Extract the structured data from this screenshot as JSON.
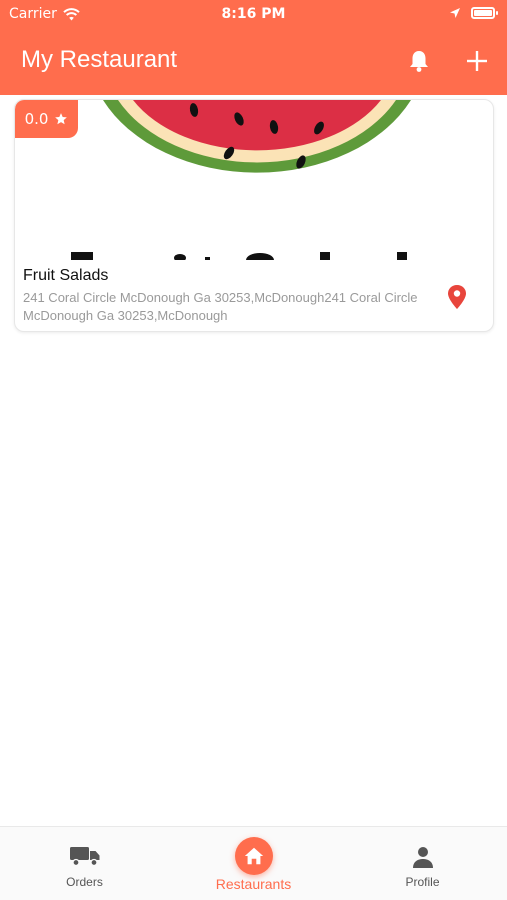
{
  "status_bar": {
    "carrier": "Carrier",
    "time": "8:16 PM"
  },
  "nav": {
    "title": "My Restaurant",
    "icons": [
      "bell-icon",
      "plus-icon"
    ]
  },
  "restaurant": {
    "rating": "0.0",
    "name": "Fruit Salads",
    "address": "241 Coral Circle McDonough Ga 30253,McDonough241 Coral Circle McDonough Ga 30253,McDonough"
  },
  "tabbar": {
    "orders": "Orders",
    "restaurants": "Restaurants",
    "profile": "Profile"
  },
  "colors": {
    "accent": "#ff6d4d",
    "pin": "#e8453c",
    "watermelon_red": "#dc2f45",
    "watermelon_rind": "#5e9a3a",
    "watermelon_pith": "#fbe3b6"
  }
}
